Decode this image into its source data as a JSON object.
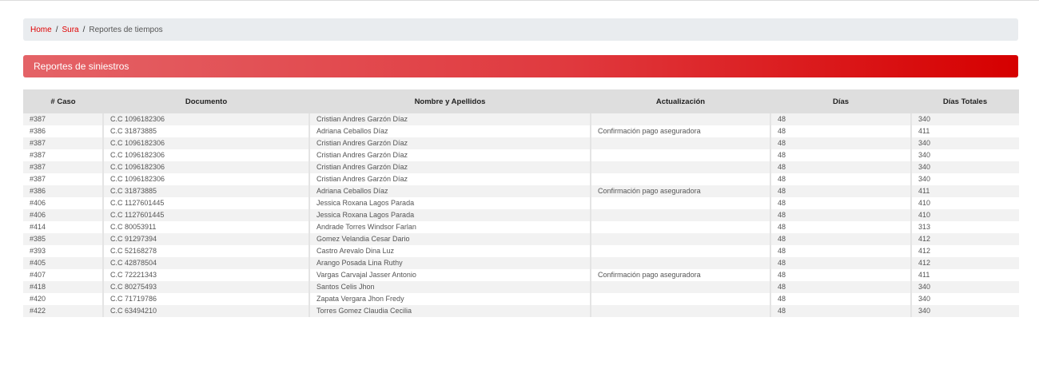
{
  "breadcrumb": {
    "home": "Home",
    "sura": "Sura",
    "current": "Reportes de tiempos"
  },
  "banner": {
    "title": "Reportes de siniestros"
  },
  "colors": {
    "accent": "#d60000",
    "link": "#e00000"
  },
  "table": {
    "headers": [
      "# Caso",
      "Documento",
      "Nombre y Apellidos",
      "Actualización",
      "Días",
      "Días Totales"
    ],
    "rows": [
      [
        "#387",
        "C.C 1096182306",
        "Cristian Andres Garzón Díaz",
        "",
        "48",
        "340"
      ],
      [
        "#386",
        "C.C 31873885",
        "Adriana Ceballos Díaz",
        "Confirmación pago aseguradora",
        "48",
        "411"
      ],
      [
        "#387",
        "C.C 1096182306",
        "Cristian Andres Garzón Díaz",
        "",
        "48",
        "340"
      ],
      [
        "#387",
        "C.C 1096182306",
        "Cristian Andres Garzón Díaz",
        "",
        "48",
        "340"
      ],
      [
        "#387",
        "C.C 1096182306",
        "Cristian Andres Garzón Díaz",
        "",
        "48",
        "340"
      ],
      [
        "#387",
        "C.C 1096182306",
        "Cristian Andres Garzón Díaz",
        "",
        "48",
        "340"
      ],
      [
        "#386",
        "C.C 31873885",
        "Adriana Ceballos Díaz",
        "Confirmación pago aseguradora",
        "48",
        "411"
      ],
      [
        "#406",
        "C.C 1127601445",
        "Jessica Roxana Lagos Parada",
        "",
        "48",
        "410"
      ],
      [
        "#406",
        "C.C 1127601445",
        "Jessica Roxana Lagos Parada",
        "",
        "48",
        "410"
      ],
      [
        "#414",
        "C.C 80053911",
        "Andrade Torres Windsor Farlan",
        "",
        "48",
        "313"
      ],
      [
        "#385",
        "C.C 91297394",
        "Gomez Velandia Cesar Dario",
        "",
        "48",
        "412"
      ],
      [
        "#393",
        "C.C 52168278",
        "Castro Arevalo Dina Luz",
        "",
        "48",
        "412"
      ],
      [
        "#405",
        "C.C 42878504",
        "Arango Posada Lina Ruthy",
        "",
        "48",
        "412"
      ],
      [
        "#407",
        "C.C 72221343",
        "Vargas Carvajal Jasser Antonio",
        "Confirmación pago aseguradora",
        "48",
        "411"
      ],
      [
        "#418",
        "C.C 80275493",
        "Santos Celis Jhon",
        "",
        "48",
        "340"
      ],
      [
        "#420",
        "C.C 71719786",
        "Zapata Vergara Jhon Fredy",
        "",
        "48",
        "340"
      ],
      [
        "#422",
        "C.C 63494210",
        "Torres Gomez Claudia Cecilia",
        "",
        "48",
        "340"
      ]
    ]
  }
}
